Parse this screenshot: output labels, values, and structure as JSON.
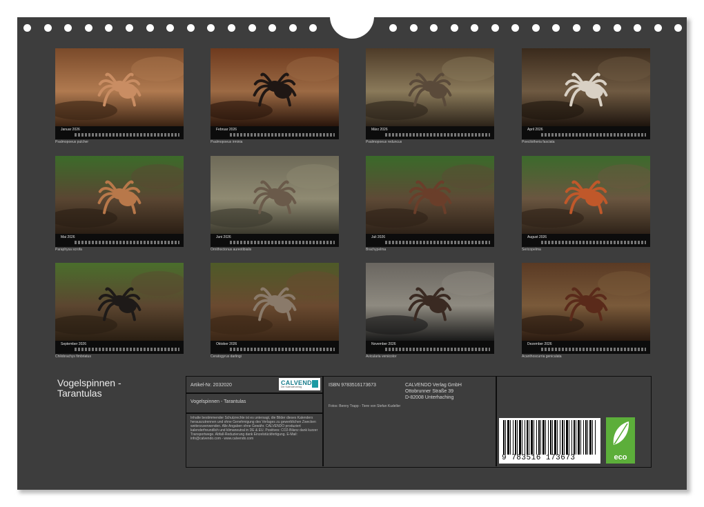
{
  "calendar": {
    "title": "Vogelspinnen - Tarantulas"
  },
  "months": [
    {
      "name": "Januar 2026",
      "caption": "Psalmopoeus pulcher"
    },
    {
      "name": "Februar 2026",
      "caption": "Psalmopoeus irminia"
    },
    {
      "name": "März 2026",
      "caption": "Psalmopoeus reduncus"
    },
    {
      "name": "April 2026",
      "caption": "Poecilotheria fasciata"
    },
    {
      "name": "Mai 2026",
      "caption": "Paraphysa scrofa"
    },
    {
      "name": "Juni 2026",
      "caption": "Ornithoctonus aureotibialis"
    },
    {
      "name": "Juli 2026",
      "caption": "Brachypelma"
    },
    {
      "name": "August 2026",
      "caption": "Sericopelma"
    },
    {
      "name": "September 2026",
      "caption": "Chilobrachys fimbriatus"
    },
    {
      "name": "Oktober 2026",
      "caption": "Ceratogyrus darlingi"
    },
    {
      "name": "November 2026",
      "caption": "Avicularia versicolor"
    },
    {
      "name": "Dezember 2026",
      "caption": "Acanthoscurria geniculata"
    }
  ],
  "info": {
    "article": "Artikel-Nr. 2032020",
    "publisher_logo": "CALVENDO",
    "publisher_logo_sub": "Der Kalenderverlag",
    "product_title": "Vogelspinnen - Tarantulas",
    "isbn": "ISBN 9783516173673",
    "publisher_name": "CALVENDO Verlag GmbH",
    "publisher_street": "Ottobrunner Straße 39",
    "publisher_city": "D-82008 Unterhaching",
    "photo_credit": "Fotos: Benny Trapp - Tiere von Stefan Kudeller",
    "legal_text": "Inhalte bestimmender Schutzrechte ist es untersagt, die Bilder dieses Kalenders herauszutrennen und ohne Genehmigung des Verlages zu gewerblichen Zwecken weiterzuverwenden. Alle Angaben ohne Gewähr. CALVENDO produziert kalenderfreundlich und klimaneutral in DE & EU. Positives: CO2-Bilanz dank kurzer Transportwege. Abfall-Reduzierung dank Einzelstückfertigung. E-Mail: info@calvendo.com - www.calvendo.com",
    "barcode_digits": "9 783516 173673",
    "eco_label": "eco"
  },
  "colors": {
    "sheet": "#3d3d3d",
    "bar": "#0c0c0c",
    "eco_green": "#5cae3a",
    "logo_teal": "#1a7d8c"
  }
}
